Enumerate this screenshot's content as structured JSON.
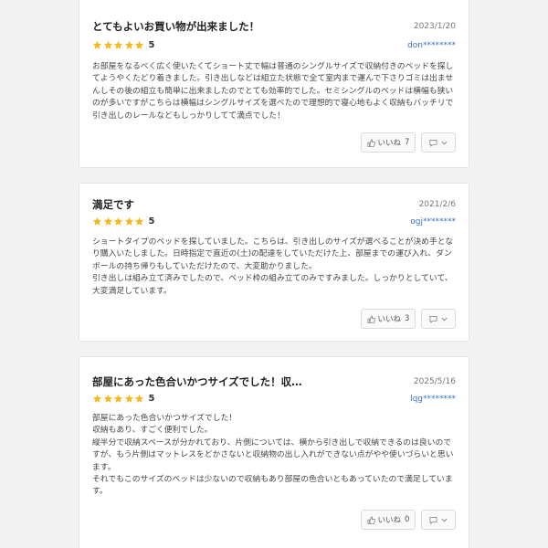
{
  "colors": {
    "star": "#f7b718",
    "reviewer_link": "#3a70c9",
    "card_border": "#e3e3e3"
  },
  "reviews": [
    {
      "title": "とてもよいお買い物が出来ました！",
      "date": "2023/1/20",
      "rating": 5,
      "rating_label": "5",
      "reviewer": "don********",
      "body": "お部屋をなるべく広く使いたくてショート丈で幅は普通のシングルサイズで収納付きのベッドを探してようやくたどり着きました。引き出しなどは組立た状態で全て室内まで運んで下さりゴミは出ませんしその後の組立も簡単に出来ましたのでとても効率的でした。セミシングルのベッドは横幅も狭いのが多いですがこちらは横幅はシングルサイズを選べたので理想的で寝心地もよく収納もバッチリで引き出しのレールなどもしっかりしてて満点でした！",
      "like_label": "いいね",
      "like_count": "7",
      "icons": [
        "star-icon",
        "thumbs-up-icon",
        "comment-icon",
        "chevron-down-icon"
      ]
    },
    {
      "title": "満足です",
      "date": "2021/2/6",
      "rating": 5,
      "rating_label": "5",
      "reviewer": "ogj********",
      "body": "ショートタイプのベッドを探していました。こちらは、引き出しのサイズが選べることが決め手となり購入いたしました。日時指定で直近の(土)の配達をしていただけた上、部屋までの運び入れ、ダンボールの持ち帰りもしていただけたので、大変助かりました。\n引き出しは組み立て済みでしたので、ベッド枠の組み立てのみですみました。しっかりとしていて、大変満足しています。",
      "like_label": "いいね",
      "like_count": "3",
      "icons": [
        "star-icon",
        "thumbs-up-icon",
        "comment-icon",
        "chevron-down-icon"
      ]
    },
    {
      "title": "部屋にあった色合いかつサイズでした！収…",
      "date": "2025/5/16",
      "rating": 5,
      "rating_label": "5",
      "reviewer": "lqg********",
      "body": "部屋にあった色合いかつサイズでした！\n収納もあり、すごく便利でした。\n縦半分で収納スペースが分かれており、片側については、横から引き出しで収納できるのは良いのですが、もう片側はマットレスをどかさないと収納物の出し入れができない点がやや使いづらいと思います。\nそれでもこのサイズのベッドは少ないので収納もあり部屋の色合いともあっていたので満足しています。",
      "like_label": "いいね",
      "like_count": "0",
      "icons": [
        "star-icon",
        "thumbs-up-icon",
        "comment-icon",
        "chevron-down-icon"
      ]
    }
  ]
}
